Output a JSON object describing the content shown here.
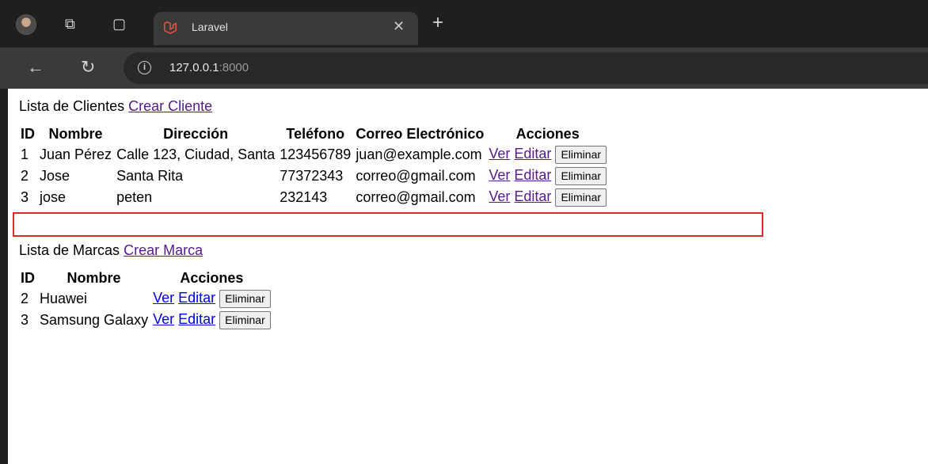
{
  "browser": {
    "tab_title": "Laravel",
    "url_host": "127.0.0.1",
    "url_port": ":8000",
    "icons": [
      "avatar",
      "workspaces-icon",
      "tab-strip-icon",
      "laravel-logo-icon",
      "close-icon",
      "new-tab-icon",
      "back-icon",
      "reload-icon",
      "info-icon"
    ]
  },
  "clientes": {
    "heading": "Lista de Clientes",
    "create_link": "Crear Cliente",
    "columns": [
      "ID",
      "Nombre",
      "Dirección",
      "Teléfono",
      "Correo Electrónico",
      "Acciones"
    ],
    "rows": [
      {
        "id": "1",
        "nombre": "Juan Pérez",
        "direccion": "Calle 123, Ciudad, Santa",
        "telefono": "123456789",
        "correo": "juan@example.com"
      },
      {
        "id": "2",
        "nombre": "Jose",
        "direccion": "Santa Rita",
        "telefono": "77372343",
        "correo": "correo@gmail.com"
      },
      {
        "id": "3",
        "nombre": "jose",
        "direccion": "peten",
        "telefono": "232143",
        "correo": "correo@gmail.com"
      }
    ],
    "highlighted_row": 3
  },
  "marcas": {
    "heading": "Lista de Marcas",
    "create_link": "Crear Marca",
    "columns": [
      "ID",
      "Nombre",
      "Acciones"
    ],
    "rows": [
      {
        "id": "2",
        "nombre": "Huawei"
      },
      {
        "id": "3",
        "nombre": "Samsung Galaxy"
      }
    ]
  },
  "actions": {
    "ver": "Ver",
    "editar": "Editar",
    "eliminar": "Eliminar"
  },
  "colors": {
    "highlight": "#e02a2a",
    "visited_link": "#551a8b",
    "link": "#0000ee"
  }
}
